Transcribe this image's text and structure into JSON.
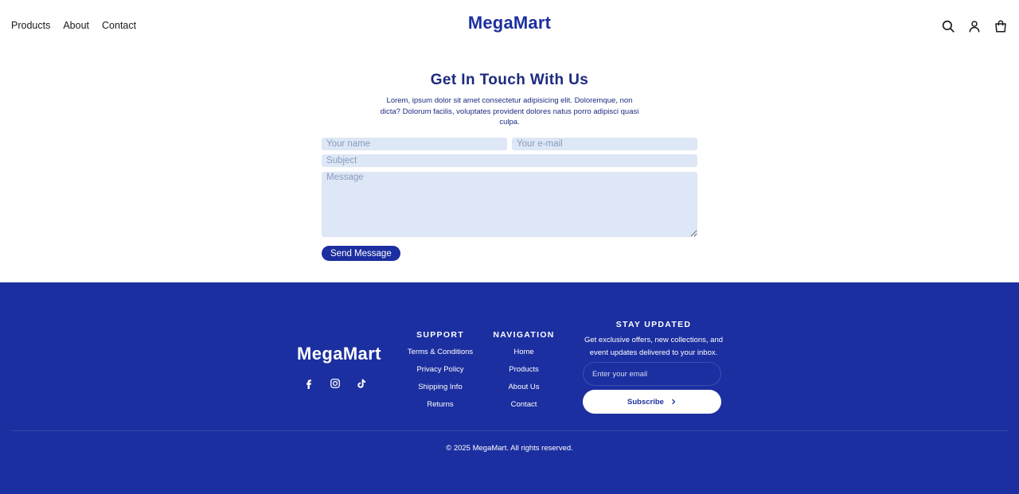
{
  "header": {
    "nav": [
      {
        "label": "Products"
      },
      {
        "label": "About"
      },
      {
        "label": "Contact"
      }
    ],
    "brand": "MegaMart",
    "icons": [
      "search-icon",
      "user-icon",
      "shopping-bag-icon"
    ]
  },
  "contact": {
    "title": "Get In Touch With Us",
    "lead": "Lorem, ipsum dolor sit amet consectetur adipisicing elit. Doloremque, non dicta? Dolorum facilis, voluptates provident dolores natus porro adipisci quasi culpa.",
    "form": {
      "name_placeholder": "Your name",
      "email_placeholder": "Your e-mail",
      "subject_placeholder": "Subject",
      "message_placeholder": "Message",
      "name_value": "",
      "email_value": "",
      "subject_value": "",
      "message_value": "",
      "submit_label": "Send Message"
    }
  },
  "footer": {
    "brand": "MegaMart",
    "socials": [
      "facebook-icon",
      "instagram-icon",
      "tiktok-icon"
    ],
    "support": {
      "heading": "SUPPORT",
      "links": [
        {
          "label": "Terms & Conditions"
        },
        {
          "label": "Privacy Policy"
        },
        {
          "label": "Shipping Info"
        },
        {
          "label": "Returns"
        }
      ]
    },
    "navigation": {
      "heading": "NAVIGATION",
      "links": [
        {
          "label": "Home"
        },
        {
          "label": "Products"
        },
        {
          "label": "About Us"
        },
        {
          "label": "Contact"
        }
      ]
    },
    "newsletter": {
      "heading": "STAY UPDATED",
      "text": "Get exclusive offers, new collections, and event updates delivered to your inbox.",
      "email_placeholder": "Enter your email",
      "email_value": "",
      "button_label": "Subscribe"
    },
    "copyright": "© 2025 MegaMart. All rights reserved."
  },
  "colors": {
    "brand": "#1c2fa0",
    "input_bg": "#dde7f5",
    "footer_bg": "#1c2fa0",
    "heading_text": "#1c2a80"
  }
}
